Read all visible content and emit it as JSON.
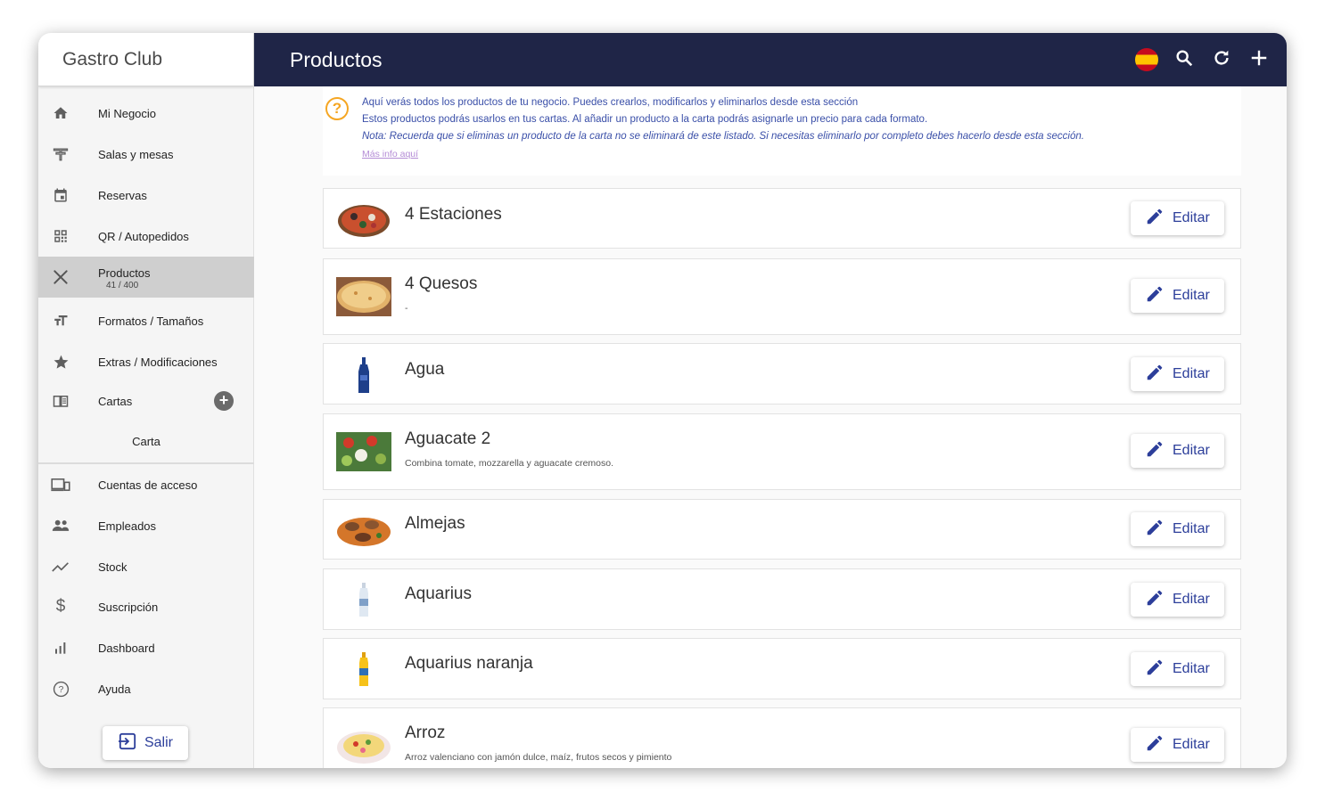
{
  "app": {
    "brand": "Gastro Club",
    "header_title": "Productos",
    "icons": [
      "spain-flag-icon",
      "search-icon",
      "refresh-icon",
      "add-icon"
    ]
  },
  "sidebar": {
    "items": [
      {
        "label": "Mi Negocio",
        "icon": "home-icon"
      },
      {
        "label": "Salas y mesas",
        "icon": "table-icon"
      },
      {
        "label": "Reservas",
        "icon": "calendar-icon"
      },
      {
        "label": "QR / Autopedidos",
        "icon": "qr-icon"
      },
      {
        "label": "Productos",
        "sub": "41 / 400",
        "icon": "utensils-icon"
      },
      {
        "label": "Formatos / Tamaños",
        "icon": "text-size-icon"
      },
      {
        "label": "Extras / Modificaciones",
        "icon": "star-icon"
      },
      {
        "label": "Cartas",
        "icon": "menu-book-icon"
      },
      {
        "label": "Cuentas de acceso",
        "icon": "devices-icon"
      },
      {
        "label": "Empleados",
        "icon": "people-icon"
      },
      {
        "label": "Stock",
        "icon": "trending-icon"
      },
      {
        "label": "Suscripción",
        "icon": "dollar-icon"
      },
      {
        "label": "Dashboard",
        "icon": "bar-chart-icon"
      },
      {
        "label": "Ayuda",
        "icon": "help-icon"
      }
    ],
    "carta_sub": "Carta",
    "logout_label": "Salir"
  },
  "info": {
    "line1": "Aquí verás todos los productos de tu negocio. Puedes crearlos, modificarlos y eliminarlos desde esta sección",
    "line2": "Estos productos podrás usarlos en tus cartas. Al añadir un producto a la carta podrás asignarle un precio para cada formato.",
    "line3": "Nota: Recuerda que si eliminas un producto de la carta no se eliminará de este listado. Si necesitas eliminarlo por completo debes hacerlo desde esta sección.",
    "link": "Más info aquí"
  },
  "products": [
    {
      "name": "4 Estaciones",
      "desc": "",
      "image": "pizza-image"
    },
    {
      "name": "4 Quesos",
      "desc": "-",
      "image": "pizza-image"
    },
    {
      "name": "Agua",
      "desc": "",
      "image": "water-bottle-image"
    },
    {
      "name": "Aguacate 2",
      "desc": "Combina tomate, mozzarella y aguacate cremoso.",
      "image": "salad-image"
    },
    {
      "name": "Almejas",
      "desc": "",
      "image": "clams-image"
    },
    {
      "name": "Aquarius",
      "desc": "",
      "image": "bottle-image"
    },
    {
      "name": "Aquarius naranja",
      "desc": "",
      "image": "orange-bottle-image"
    },
    {
      "name": "Arroz",
      "desc": "Arroz valenciano con jamón dulce, maíz, frutos secos y pimiento",
      "image": "rice-image"
    }
  ],
  "edit_label": "Editar",
  "colors": {
    "header": "#1f2547",
    "accent": "#2c3e9a",
    "active_item": "#cfcfcf",
    "info_icon": "#f5a623"
  }
}
